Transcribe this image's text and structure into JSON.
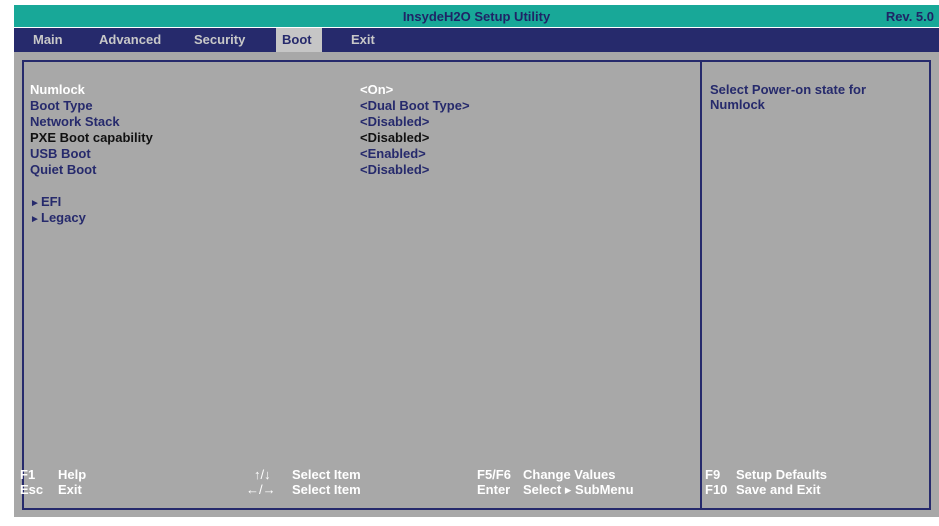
{
  "header": {
    "title": "InsydeH2O Setup Utility",
    "revision": "Rev. 5.0"
  },
  "tabs": [
    {
      "label": "Main"
    },
    {
      "label": "Advanced"
    },
    {
      "label": "Security"
    },
    {
      "label": "Boot"
    },
    {
      "label": "Exit"
    }
  ],
  "settings": [
    {
      "label": "Numlock",
      "value": "<On>"
    },
    {
      "label": "Boot Type",
      "value": "<Dual Boot Type>"
    },
    {
      "label": "Network Stack",
      "value": "<Disabled>"
    },
    {
      "label": "PXE Boot capability",
      "value": "<Disabled>"
    },
    {
      "label": "USB Boot",
      "value": "<Enabled>"
    },
    {
      "label": "Quiet Boot",
      "value": "<Disabled>"
    }
  ],
  "submenus": [
    {
      "label": "EFI"
    },
    {
      "label": "Legacy"
    }
  ],
  "help_text": "Select Power-on state for Numlock",
  "footer": [
    {
      "key": "F1",
      "desc": "Help"
    },
    {
      "key": "Esc",
      "desc": "Exit"
    },
    {
      "key": "↑/↓",
      "desc": "Select Item"
    },
    {
      "key": "←/→",
      "desc": "Select Item"
    },
    {
      "key": "F5/F6",
      "desc": "Change Values"
    },
    {
      "key": "Enter",
      "desc": "Select ▸ SubMenu"
    },
    {
      "key": "F9",
      "desc": "Setup Defaults"
    },
    {
      "key": "F10",
      "desc": "Save and Exit"
    }
  ],
  "colors": {
    "title_bar": "#18a898",
    "menu_bar": "#262a6c",
    "panel": "#a8a8a8",
    "selected_text": "#ffffff",
    "item_text": "#262a6c"
  }
}
